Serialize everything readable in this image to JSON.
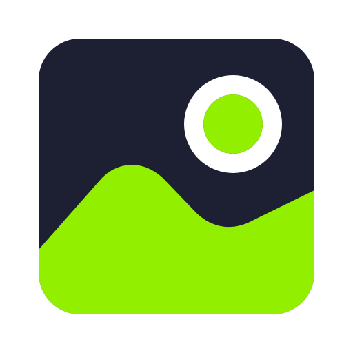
{
  "icon": {
    "name": "image-placeholder-icon",
    "colors": {
      "background": "#ffffff",
      "frame": "#1d1f33",
      "accent": "#93ef00",
      "ring": "#ffffff"
    }
  }
}
